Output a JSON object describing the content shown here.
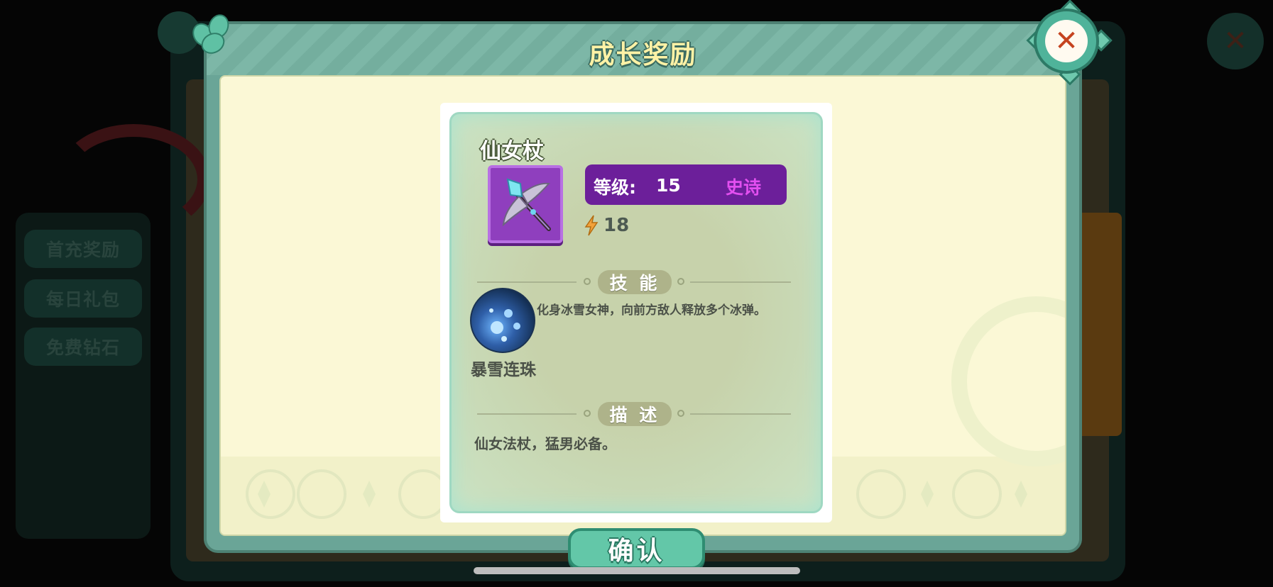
{
  "background": {
    "side_buttons": [
      "首充奖励",
      "每日礼包",
      "免费钻石"
    ]
  },
  "dialog": {
    "title": "成长奖励",
    "close_icon": "close-x-icon",
    "confirm_label": "确认"
  },
  "item": {
    "name": "仙女杖",
    "icon": "fairy-staff-icon",
    "level_label": "等级:",
    "level": "15",
    "rarity": "史诗",
    "rarity_color": "#e34ff0",
    "power": "18",
    "skill_section_title": "技 能",
    "skill": {
      "name": "暴雪连珠",
      "icon": "blizzard-orbs-icon",
      "description": "化身冰雪女神，向前方敌人释放多个冰弹。"
    },
    "description_section_title": "描 述",
    "description": "仙女法杖，猛男必备。"
  },
  "colors": {
    "panel": "#6aa597",
    "body": "#fbf8d6",
    "epic_bar": "#6c1f9a",
    "title_text": "#fff2a6"
  }
}
